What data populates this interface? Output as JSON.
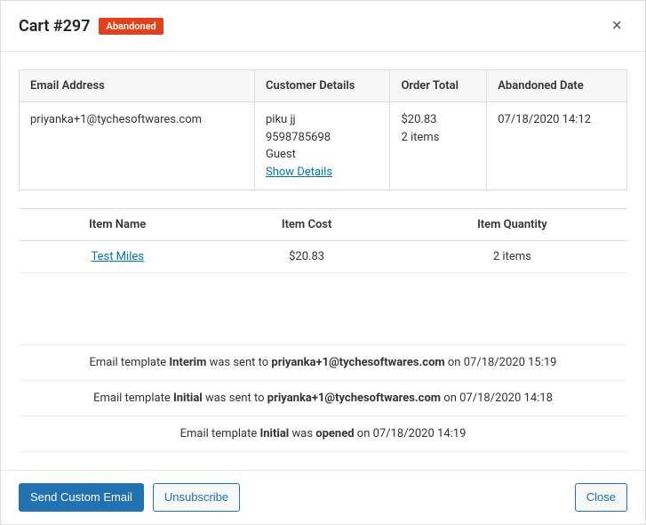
{
  "header": {
    "title": "Cart #297",
    "badge": "Abandoned",
    "close_icon": "×"
  },
  "info_table": {
    "headers": {
      "email": "Email Address",
      "customer": "Customer Details",
      "total": "Order Total",
      "date": "Abandoned Date"
    },
    "row": {
      "email": "priyanka+1@tychesoftwares.com",
      "customer_name": "piku jj",
      "customer_phone": "9598785698",
      "customer_type": "Guest",
      "show_details": "Show Details",
      "total_amount": "$20.83",
      "total_items": "2 items",
      "date": "07/18/2020 14:12"
    }
  },
  "items_table": {
    "headers": {
      "name": "Item Name",
      "cost": "Item Cost",
      "qty": "Item Quantity"
    },
    "row": {
      "name": "Test Miles",
      "cost": "$20.83",
      "qty": "2 items"
    }
  },
  "logs": {
    "line1": {
      "prefix": "Email template ",
      "template": "Interim",
      "mid": " was sent to ",
      "recipient": "priyanka+1@tychesoftwares.com",
      "suffix": " on 07/18/2020 15:19"
    },
    "line2": {
      "prefix": "Email template ",
      "template": "Initial",
      "mid": " was sent to ",
      "recipient": "priyanka+1@tychesoftwares.com",
      "suffix": " on 07/18/2020 14:18"
    },
    "line3": {
      "prefix": "Email template ",
      "template": "Initial",
      "mid": " was ",
      "action": "opened",
      "suffix": " on 07/18/2020 14:19"
    }
  },
  "footer": {
    "send_email": "Send Custom Email",
    "unsubscribe": "Unsubscribe",
    "close": "Close"
  }
}
